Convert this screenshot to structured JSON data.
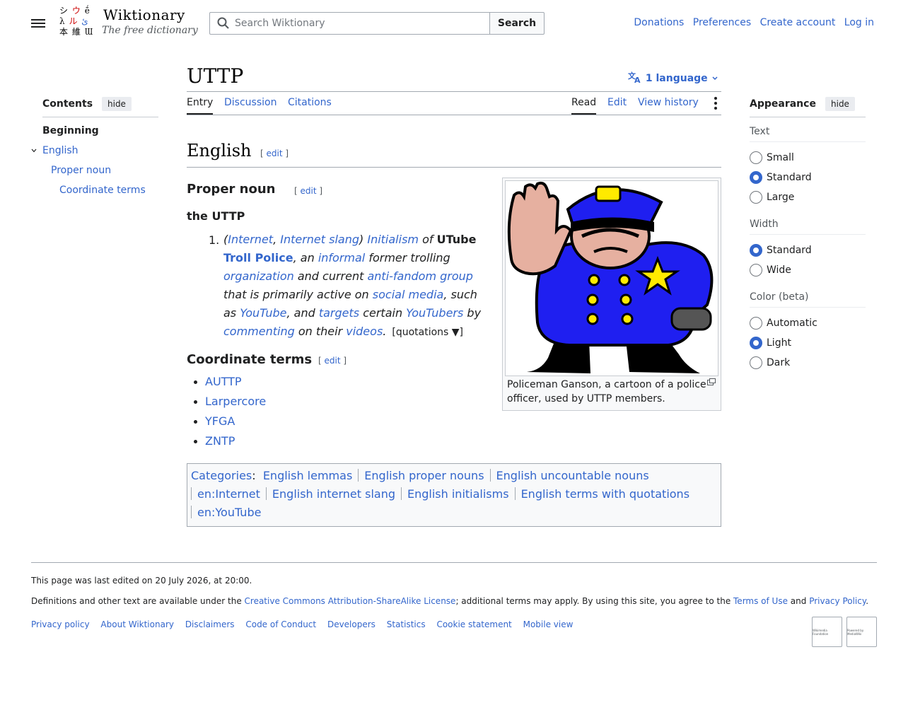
{
  "header": {
    "logo_glyphs": [
      "シ",
      "ウ",
      "ḗ",
      "λ",
      "ル",
      "ئ",
      "本",
      "維",
      "Ɯ"
    ],
    "wordmark": "Wiktionary",
    "tagline": "The free dictionary",
    "search_placeholder": "Search Wiktionary",
    "search_button": "Search",
    "user_links": [
      "Donations",
      "Preferences",
      "Create account",
      "Log in"
    ]
  },
  "toc": {
    "title": "Contents",
    "hide": "hide",
    "items": [
      {
        "label": "Beginning",
        "level": 0
      },
      {
        "label": "English",
        "level": 1
      },
      {
        "label": "Proper noun",
        "level": 2
      },
      {
        "label": "Coordinate terms",
        "level": 3
      }
    ]
  },
  "page": {
    "title": "UTTP",
    "language_button": "1 language",
    "tabs_left": [
      "Entry",
      "Discussion",
      "Citations"
    ],
    "tabs_right": [
      "Read",
      "Edit",
      "View history"
    ]
  },
  "content": {
    "english_heading": "English",
    "edit_label": "edit",
    "proper_noun_heading": "Proper noun",
    "headword": "the UTTP",
    "definition": {
      "number": "1.",
      "labels": [
        "Internet",
        "Internet slang"
      ],
      "initialism": "Initialism",
      "of": "of",
      "expansion_1": "UTube",
      "expansion_2": "Troll Police",
      "t1": ", an ",
      "informal": "informal",
      "t2": " former trolling ",
      "organization": "organization",
      "t3": " and current ",
      "anti_fandom": "anti-fandom group",
      "t4": " that is primarily active on ",
      "social_media": "social media",
      "t5": ", such as ",
      "youtube": "YouTube",
      "t6": ", and ",
      "targets": "targets",
      "t7": " certain ",
      "youtubers": "YouTubers",
      "t8": " by ",
      "commenting": "commenting",
      "t9": " on their ",
      "videos": "videos",
      "t10": ".",
      "quotations": "[quotations ▼]"
    },
    "coord_heading": "Coordinate terms",
    "coord_terms": [
      "AUTTP",
      "Larpercore",
      "YFGA",
      "ZNTP"
    ],
    "image_caption": "Policeman Ganson, a cartoon of a police officer, used by UTTP members."
  },
  "categories": {
    "label": "Categories",
    "items": [
      "English lemmas",
      "English proper nouns",
      "English uncountable nouns",
      "en:Internet",
      "English internet slang",
      "English initialisms",
      "English terms with quotations",
      "en:YouTube"
    ]
  },
  "appearance": {
    "title": "Appearance",
    "hide": "hide",
    "text_label": "Text",
    "text_options": [
      "Small",
      "Standard",
      "Large"
    ],
    "text_selected": "Standard",
    "width_label": "Width",
    "width_options": [
      "Standard",
      "Wide"
    ],
    "width_selected": "Standard",
    "color_label": "Color (beta)",
    "color_options": [
      "Automatic",
      "Light",
      "Dark"
    ],
    "color_selected": "Light"
  },
  "footer": {
    "last_edited": "This page was last edited on 20 July 2026, at 20:00.",
    "license_pre": "Definitions and other text are available under the ",
    "license_link": "Creative Commons Attribution-ShareAlike License",
    "license_mid": "; additional terms may apply. By using this site, you agree to the ",
    "terms_link": "Terms of Use",
    "and": " and ",
    "privacy_link": "Privacy Policy",
    "period": ".",
    "links": [
      "Privacy policy",
      "About Wiktionary",
      "Disclaimers",
      "Code of Conduct",
      "Developers",
      "Statistics",
      "Cookie statement",
      "Mobile view"
    ],
    "badges": [
      "Wikimedia Foundation",
      "Powered by MediaWiki"
    ]
  },
  "colors": {
    "link": "#3366cc",
    "text": "#202122",
    "accent": "#3366cc"
  }
}
